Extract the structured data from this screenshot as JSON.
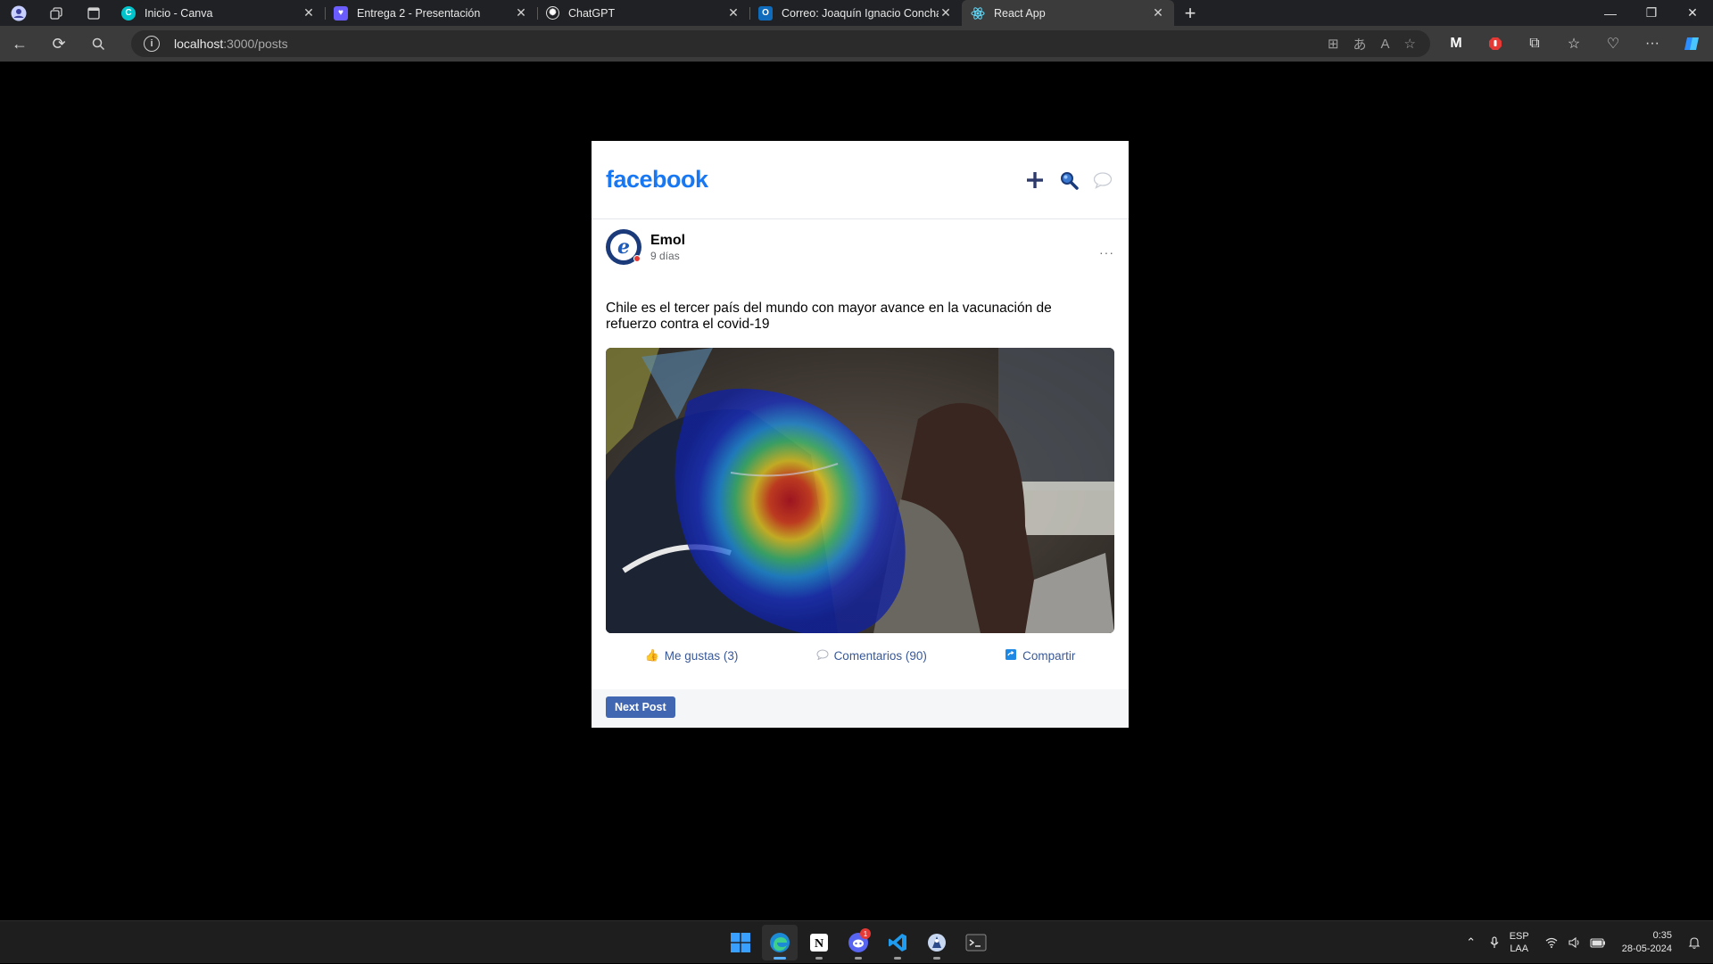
{
  "browser": {
    "tabs": [
      {
        "title": "Inicio - Canva",
        "favicon": "canva-icon",
        "color": "#7d2ae8",
        "active": false
      },
      {
        "title": "Entrega 2 - Presentación",
        "favicon": "shield-app-icon",
        "color": "#6b5cff",
        "active": false
      },
      {
        "title": "ChatGPT",
        "favicon": "chatgpt-icon",
        "color": "#5a5a5a",
        "active": false
      },
      {
        "title": "Correo: Joaquín Ignacio Concha",
        "favicon": "outlook-icon",
        "color": "#0f6cbd",
        "active": false
      },
      {
        "title": "React App",
        "favicon": "react-icon",
        "color": "#61dafb",
        "active": true
      }
    ],
    "url": {
      "host": "localhost",
      "path": ":3000/posts"
    }
  },
  "app": {
    "logo": "facebook",
    "brand_color": "#1877f2",
    "header_icons": [
      "plus-icon",
      "search-icon",
      "chat-bubble-icon"
    ]
  },
  "post": {
    "author": "Emol",
    "time": "9 días",
    "text": "Chile es el tercer país del mundo con mayor avance en la vacunación de refuerzo contra el covid-19",
    "image_icon": "vaccination-photo-with-heatmap",
    "actions": {
      "like": "Me gustas (3)",
      "comments": "Comentarios (90)",
      "share": "Compartir"
    },
    "link_color": "#385898"
  },
  "footer": {
    "next_button": "Next Post",
    "button_color": "#4267b2"
  },
  "taskbar": {
    "apps": [
      "windows-start-icon",
      "edge-icon",
      "notion-icon",
      "discord-icon",
      "vscode-icon",
      "app-icon",
      "terminal-icon"
    ],
    "discord_badge": "1",
    "lang_top": "ESP",
    "lang_bottom": "LAA",
    "time": "0:35",
    "date": "28-05-2024"
  }
}
